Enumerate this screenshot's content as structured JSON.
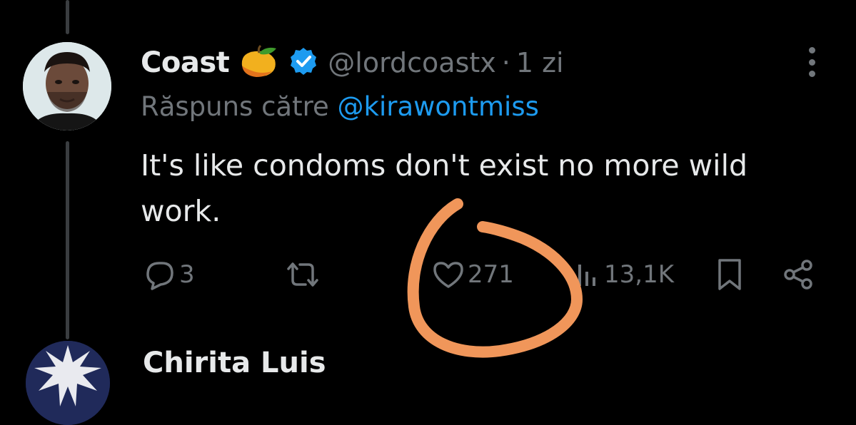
{
  "tweet": {
    "display_name": "Coast",
    "handle": "@lordcoastx",
    "separator": "·",
    "time": "1 zi",
    "reply_prefix": "Răspuns către",
    "reply_mention": "@kirawontmiss",
    "text": "It's like condoms don't exist no more wild work."
  },
  "actions": {
    "replies": "3",
    "likes": "271",
    "views": "13,1K"
  },
  "icons": {
    "name_emoji": "mango-icon",
    "verified": "verified-badge-icon",
    "more": "more-vertical-icon",
    "reply": "speech-bubble-icon",
    "retweet": "retweet-icon",
    "like": "heart-icon",
    "views": "bar-chart-icon",
    "bookmark": "bookmark-icon",
    "share": "share-icon"
  },
  "next_tweet": {
    "display_name": "Chirita Luis"
  },
  "colors": {
    "background": "#000000",
    "text": "#e7e9ea",
    "muted": "#71767b",
    "link": "#1d9bf0",
    "verified": "#1d9bf0",
    "annotation": "#f0965a"
  }
}
